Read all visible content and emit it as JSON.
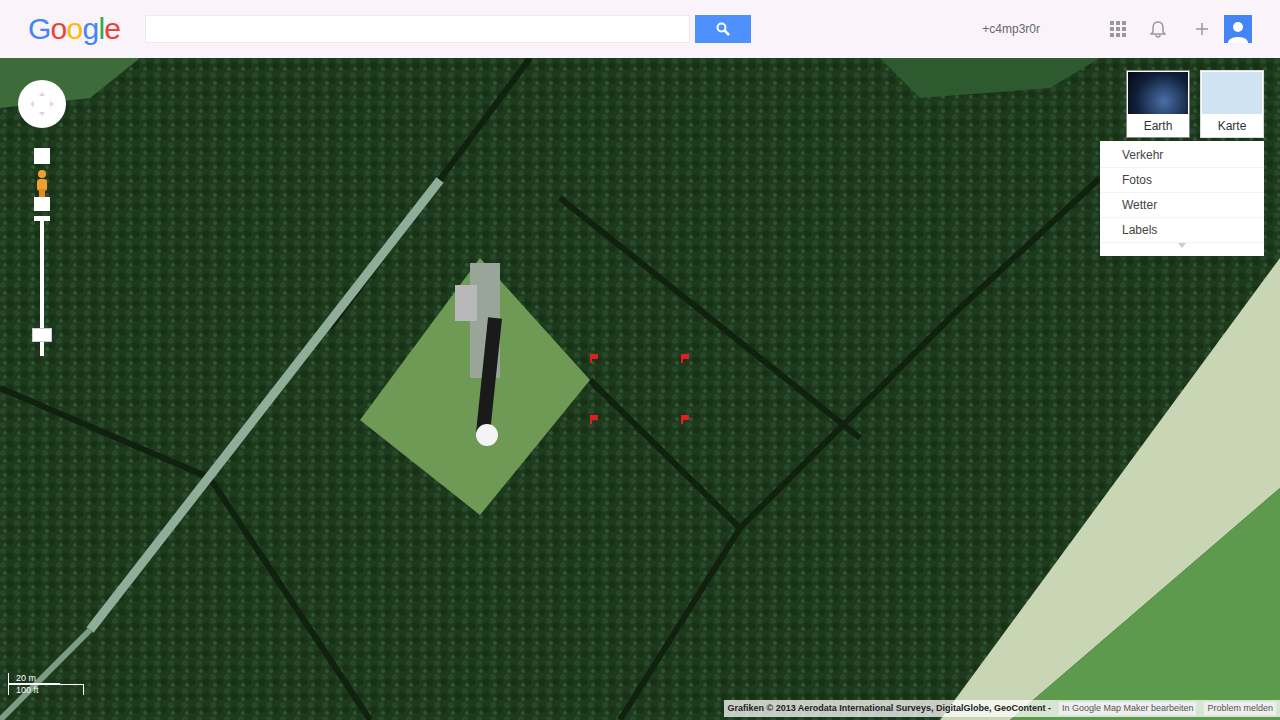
{
  "header": {
    "logo": [
      {
        "letter": "G",
        "color": "#4285f4"
      },
      {
        "letter": "o",
        "color": "#ea4335"
      },
      {
        "letter": "o",
        "color": "#fbbc05"
      },
      {
        "letter": "g",
        "color": "#4285f4"
      },
      {
        "letter": "l",
        "color": "#34a853"
      },
      {
        "letter": "e",
        "color": "#ea4335"
      }
    ],
    "user": "+c4mp3r0r"
  },
  "map_types": [
    {
      "label": "Earth",
      "selected": true
    },
    {
      "label": "Karte",
      "selected": false
    }
  ],
  "layers": [
    {
      "label": "Verkehr"
    },
    {
      "label": "Fotos"
    },
    {
      "label": "Wetter"
    },
    {
      "label": "Labels"
    }
  ],
  "scale": {
    "metric": "20 m",
    "imperial": "100 ft"
  },
  "attribution": {
    "copyright": "Grafiken © 2013 Aerodata International Surveys, DigitalGlobe, GeoContent -",
    "links": [
      "In Google Map Maker bearbeiten",
      "Problem melden"
    ]
  }
}
